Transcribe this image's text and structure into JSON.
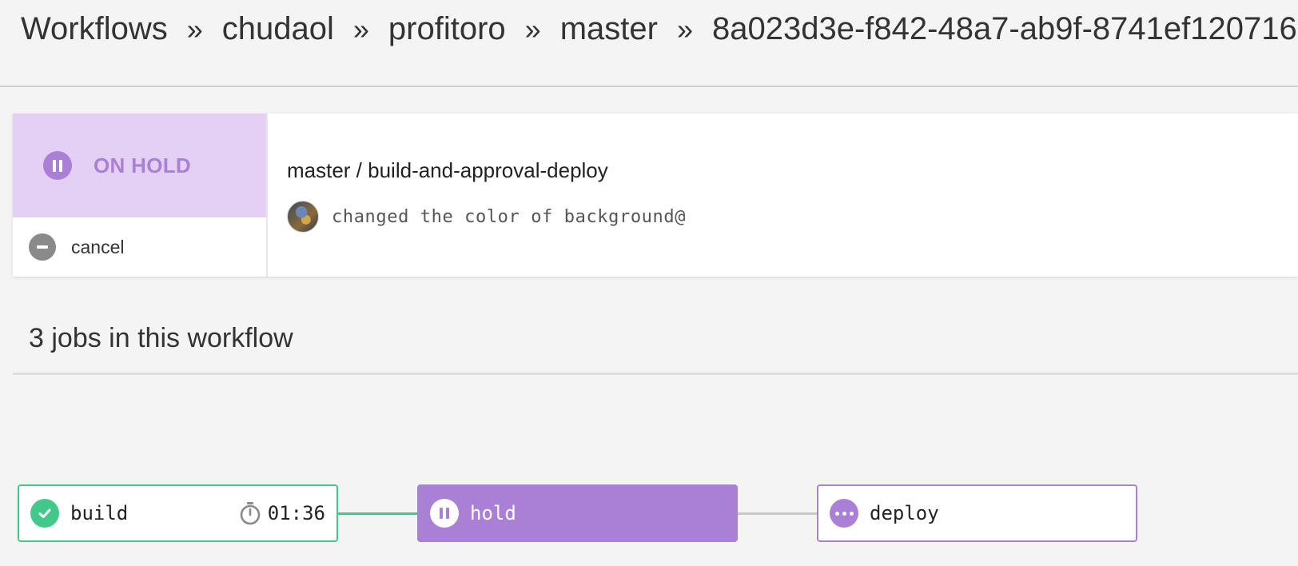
{
  "breadcrumb": {
    "items": [
      "Workflows",
      "chudaol",
      "profitoro",
      "master",
      "8a023d3e-f842-48a7-ab9f-8741ef120716"
    ],
    "separator": "»"
  },
  "workflow": {
    "status": "ON HOLD",
    "cancel_label": "cancel",
    "title": "master / build-and-approval-deploy",
    "commit_message": "changed the color of background@"
  },
  "jobs_section": {
    "heading": "3 jobs in this workflow"
  },
  "jobs": [
    {
      "name": "build",
      "status": "success",
      "duration": "01:36"
    },
    {
      "name": "hold",
      "status": "on-hold"
    },
    {
      "name": "deploy",
      "status": "queued"
    }
  ],
  "colors": {
    "hold_purple": "#aa80d6",
    "hold_bg": "#e5d0f5",
    "success_green": "#42c88a",
    "cancel_gray": "#8a8a8a"
  }
}
